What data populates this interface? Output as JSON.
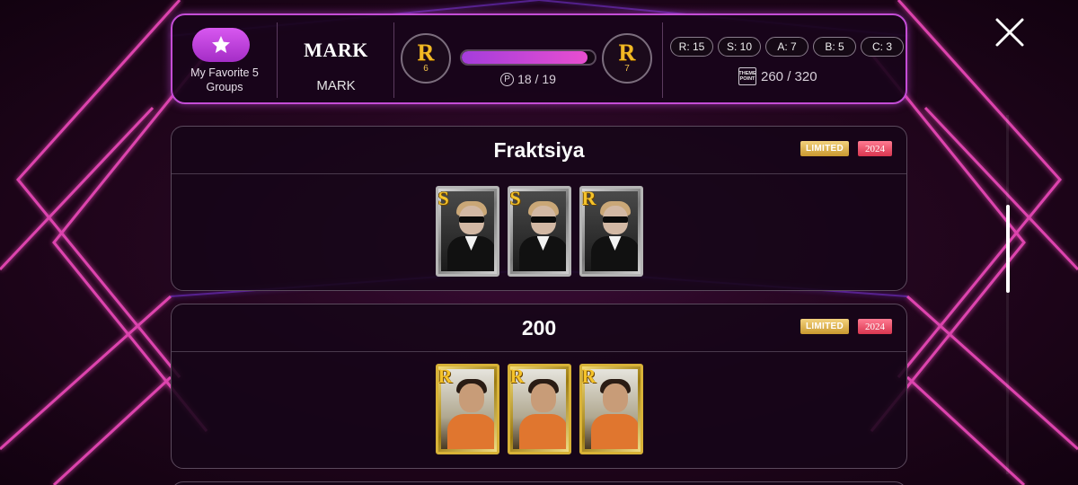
{
  "header": {
    "favorite": {
      "label": "My Favorite 5 Groups",
      "icon": "star-icon"
    },
    "artist": {
      "title": "MARK",
      "subtitle": "MARK"
    },
    "level": {
      "current_rank": "R",
      "current_level": "6",
      "next_rank": "R",
      "next_level": "7",
      "progress_label": "18 / 19",
      "progress_fraction": 0.947,
      "p_icon": "P"
    },
    "grades": [
      "R: 15",
      "S: 10",
      "A: 7",
      "B: 5",
      "C: 3"
    ],
    "theme_point": {
      "icon_line1": "THEME",
      "icon_line2": "POINT",
      "value": "260 / 320"
    }
  },
  "groups": [
    {
      "title": "Fraktsiya",
      "badge_limited": "LIMITED",
      "badge_year": "2024",
      "cards": [
        {
          "grade": "S",
          "style": "silver"
        },
        {
          "grade": "S",
          "style": "silver"
        },
        {
          "grade": "R",
          "style": "silver"
        }
      ]
    },
    {
      "title": "200",
      "badge_limited": "LIMITED",
      "badge_year": "2024",
      "cards": [
        {
          "grade": "R",
          "style": "gold"
        },
        {
          "grade": "R",
          "style": "gold"
        },
        {
          "grade": "R",
          "style": "gold"
        }
      ]
    }
  ],
  "colors": {
    "accent_border": "#c44dd6",
    "progress_start": "#a43ddc",
    "progress_end": "#e84ed0",
    "rank_gold": "#f2b925",
    "limited_badge": "#e0b24e",
    "year_badge": "#ef4f68"
  },
  "icons": {
    "close": "close-icon",
    "favorite": "star-icon"
  }
}
